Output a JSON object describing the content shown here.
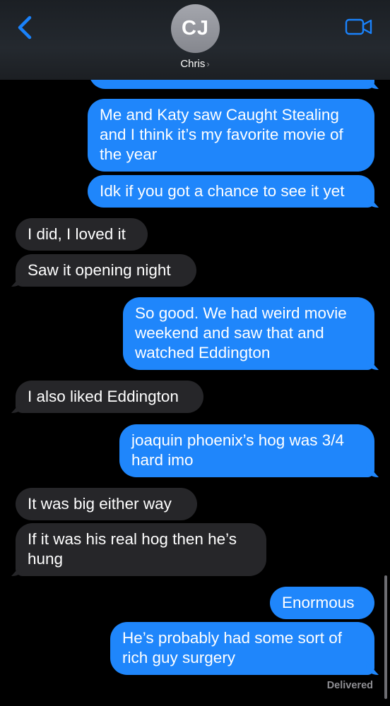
{
  "header": {
    "avatar_initials": "CJ",
    "contact_name": "Chris",
    "chevron": "›",
    "back_icon": "chevron-left",
    "video_icon": "video-camera"
  },
  "colors": {
    "outgoing_bubble": "#1f86fb",
    "incoming_bubble": "#262629",
    "accent": "#1a82fb",
    "background": "#000000"
  },
  "messages": [
    {
      "direction": "outgoing",
      "text": "Me and Katy saw Caught Stealing\nand I think it’s my favorite movie of\nthe year"
    },
    {
      "direction": "outgoing",
      "text": "Idk if you got a chance to see it yet"
    },
    {
      "direction": "incoming",
      "text": "I did, I loved it"
    },
    {
      "direction": "incoming",
      "text": "Saw it opening night"
    },
    {
      "direction": "outgoing",
      "text": "So good. We had weird movie\nweekend and saw that and\nwatched Eddington"
    },
    {
      "direction": "incoming",
      "text": "I also liked Eddington"
    },
    {
      "direction": "outgoing",
      "text": "joaquin phoenix’s hog was 3/4\nhard imo"
    },
    {
      "direction": "incoming",
      "text": "It was big either way"
    },
    {
      "direction": "incoming",
      "text": "If it was his real hog then he’s\nhung"
    },
    {
      "direction": "outgoing",
      "text": "Enormous"
    },
    {
      "direction": "outgoing",
      "text": "He’s probably had some sort of\nrich guy surgery"
    }
  ],
  "status": {
    "delivered": "Delivered"
  }
}
